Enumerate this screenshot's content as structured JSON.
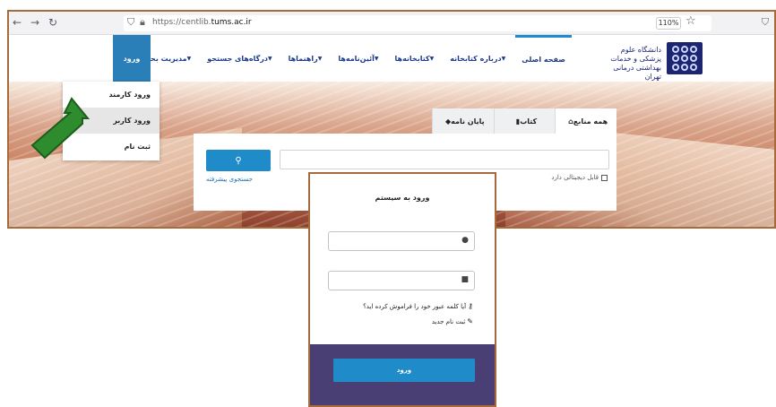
{
  "browser": {
    "url_prefix": "https://centlib.",
    "url_domain": "tums.ac.ir",
    "zoom": "110%",
    "back_icon": "arrow-left",
    "forward_icon": "arrow-right",
    "reload_icon": "reload"
  },
  "site": {
    "logo_text": "دانشگاه علوم پزشکی و خدمات بهداشتی درمانی تهران",
    "nav": [
      {
        "label": "صفحه اصلی",
        "has_chevron": false,
        "active": true
      },
      {
        "label": "درباره کتابخانه",
        "has_chevron": true
      },
      {
        "label": "کتابخانه‌ها",
        "has_chevron": true
      },
      {
        "label": "آئین‌نامه‌ها",
        "has_chevron": true
      },
      {
        "label": "راهنماها",
        "has_chevron": true
      },
      {
        "label": "درگاه‌های جستجو",
        "has_chevron": true
      },
      {
        "label": "مدیریت بحران",
        "has_chevron": true
      }
    ],
    "login_tab": "ورود",
    "dropdown": [
      "ورود کارمند",
      "ورود کاربر",
      "ثبت نام"
    ]
  },
  "search": {
    "tabs": [
      {
        "label": "همه منابع",
        "icon": "home-icon"
      },
      {
        "label": "کتاب",
        "icon": "book-icon"
      },
      {
        "label": "پایان نامه",
        "icon": "graduation-cap-icon"
      }
    ],
    "button_icon": "search-icon",
    "advanced": "جستجوی پیشرفته",
    "digital": "قابل دیجیتالی دارد"
  },
  "login": {
    "title": "ورود به سیستم",
    "forgot": "آیا کلمه عبور خود را فراموش کرده اید؟",
    "register": "ثبت نام جدید",
    "submit": "ورود"
  },
  "colors": {
    "accent": "#1f8bc8",
    "nav_text": "#1b3a8a",
    "frame": "#a86a3a",
    "login_footer": "#4a3f74",
    "arrow": "#2e8b2e"
  }
}
